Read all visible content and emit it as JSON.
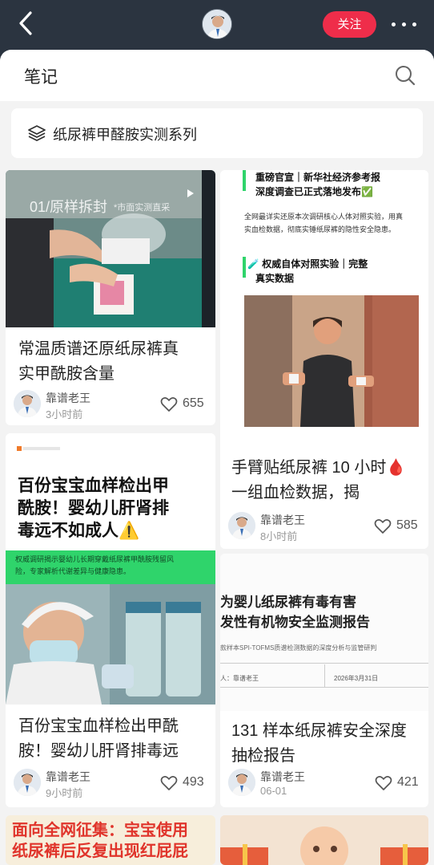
{
  "header": {
    "follow_label": "关注",
    "back_icon": "back-chevron-icon",
    "more_icon": "more-dots-icon"
  },
  "sheet": {
    "title": "笔记",
    "search_icon": "search-icon",
    "series_label": "纸尿裤甲醛胺实测系列"
  },
  "cards": [
    {
      "overlay_text": "01/原样拆封",
      "overlay_sub": "*市面实测直采",
      "title_line1": "常温质谱还原纸尿裤真",
      "title_line2": "实甲酰胺含量",
      "author": "靠谱老王",
      "time": "3小时前",
      "likes": "655"
    },
    {
      "headline1": "重磅官宣｜新华社经济参考报",
      "headline2": "深度调查已正式落地发布✅",
      "body1": "全网最详实还原本次调研核心人体对照实验，用真",
      "body2": "实血检数据，彻底实锤纸尿裤的隐性安全隐患。",
      "sub1": "🧪 权威自体对照实验｜完整",
      "sub2": "真实数据",
      "title_line1": "手臂贴纸尿裤 10 小时🩸",
      "title_line2": "一组血检数据，揭",
      "author": "靠谱老王",
      "time": "8小时前",
      "likes": "585"
    },
    {
      "big1": "百份宝宝血样检出甲",
      "big2": "酰胺！婴幼儿肝肾排",
      "big3": "毒远不如成人⚠️",
      "banner1": "权威调研揭示婴幼儿长期穿戴纸尿裤甲酰胺残留风",
      "banner2": "险，专家解析代谢差异与健康隐患。",
      "title_line1": "百份宝宝血样检出甲酰",
      "title_line2": "胺！婴幼儿肝肾排毒远",
      "author": "靠谱老王",
      "time": "9小时前",
      "likes": "493"
    },
    {
      "doc1": "为婴儿纸尿裤有毒有害",
      "doc2": "发性有机物安全监测报告",
      "doc3": "款样本SPI-TOFMS质谱检测数据的深度分析与监管研判",
      "doc4": "人：靠谱老王",
      "doc5": "2026年3月31日",
      "title_line1": "131 样本纸尿裤安全深度",
      "title_line2": "抽检报告",
      "author": "靠谱老王",
      "time": "06-01",
      "likes": "421"
    }
  ],
  "bottom": {
    "left_text1": "面向全网征集：宝宝使用",
    "left_text2": "纸尿裤后反复出现红屁屁"
  },
  "colors": {
    "accent": "#ef2d4a",
    "green": "#2fd46b",
    "topbar": "#2b3440"
  }
}
